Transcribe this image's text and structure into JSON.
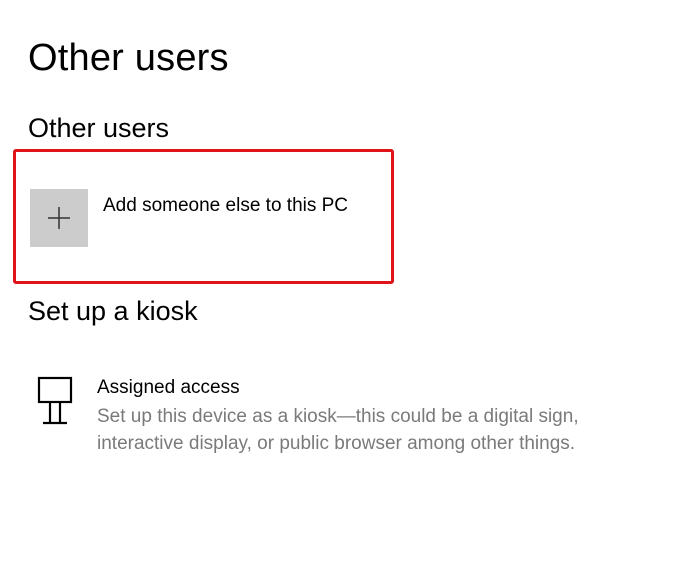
{
  "page": {
    "title": "Other users"
  },
  "other_users": {
    "heading": "Other users",
    "add_user": {
      "label": "Add someone else to this PC",
      "icon": "plus-icon",
      "tile_color": "#cccccc"
    },
    "highlight_color": "#e0131a"
  },
  "kiosk": {
    "heading": "Set up a kiosk",
    "assigned_access": {
      "title": "Assigned access",
      "description": "Set up this device as a kiosk—this could be a digital sign, interactive display, or public browser among other things.",
      "icon": "kiosk-icon"
    }
  }
}
